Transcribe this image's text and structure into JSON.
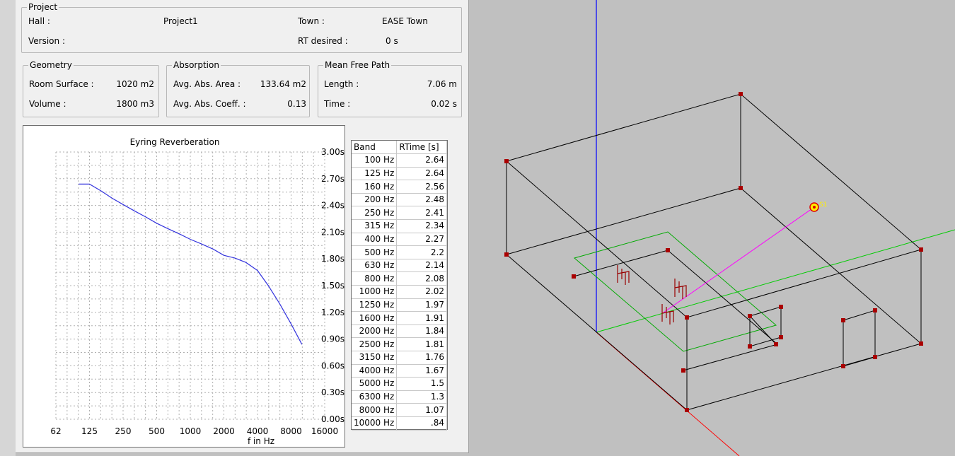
{
  "project": {
    "group_title": "Project",
    "hall_label": "Hall :",
    "hall_value": "Project1",
    "town_label": "Town :",
    "town_value": "EASE Town",
    "version_label": "Version :",
    "rt_desired_label": "RT desired :",
    "rt_desired_value": "0 s"
  },
  "geometry": {
    "group_title": "Geometry",
    "surface_label": "Room Surface :",
    "surface_value": "1020 m2",
    "volume_label": "Volume :",
    "volume_value": "1800 m3"
  },
  "absorption": {
    "group_title": "Absorption",
    "area_label": "Avg. Abs. Area :",
    "area_value": "133.64 m2",
    "coeff_label": "Avg. Abs. Coeff. :",
    "coeff_value": "0.13"
  },
  "mean_free_path": {
    "group_title": "Mean Free Path",
    "length_label": "Length :",
    "length_value": "7.06 m",
    "time_label": "Time :",
    "time_value": "0.02 s"
  },
  "table": {
    "col_band": "Band",
    "col_rtime": "RTime [s]",
    "rows": [
      {
        "band": "100 Hz",
        "rt": "2.64"
      },
      {
        "band": "125 Hz",
        "rt": "2.64"
      },
      {
        "band": "160 Hz",
        "rt": "2.56"
      },
      {
        "band": "200 Hz",
        "rt": "2.48"
      },
      {
        "band": "250 Hz",
        "rt": "2.41"
      },
      {
        "band": "315 Hz",
        "rt": "2.34"
      },
      {
        "band": "400 Hz",
        "rt": "2.27"
      },
      {
        "band": "500 Hz",
        "rt": "2.2"
      },
      {
        "band": "630 Hz",
        "rt": "2.14"
      },
      {
        "band": "800 Hz",
        "rt": "2.08"
      },
      {
        "band": "1000 Hz",
        "rt": "2.02"
      },
      {
        "band": "1250 Hz",
        "rt": "1.97"
      },
      {
        "band": "1600 Hz",
        "rt": "1.91"
      },
      {
        "band": "2000 Hz",
        "rt": "1.84"
      },
      {
        "band": "2500 Hz",
        "rt": "1.81"
      },
      {
        "band": "3150 Hz",
        "rt": "1.76"
      },
      {
        "band": "4000 Hz",
        "rt": "1.67"
      },
      {
        "band": "5000 Hz",
        "rt": "1.5"
      },
      {
        "band": "6300 Hz",
        "rt": "1.3"
      },
      {
        "band": "8000 Hz",
        "rt": "1.07"
      },
      {
        "band": "10000 Hz",
        "rt": ".84"
      }
    ]
  },
  "chart_data": {
    "type": "line",
    "title": "Eyring Reverberation",
    "xlabel": "f in Hz",
    "ylabel": "",
    "x_scale": "log",
    "xlim": [
      62,
      16000
    ],
    "ylim": [
      0,
      3.0
    ],
    "grid": true,
    "x_tick_labels": [
      "62",
      "125",
      "250",
      "500",
      "1000",
      "2000",
      "4000",
      "8000",
      "16000"
    ],
    "x_tick_values": [
      62.5,
      125,
      250,
      500,
      1000,
      2000,
      4000,
      8000,
      16000
    ],
    "y_tick_labels": [
      "3.00s",
      "2.70s",
      "2.40s",
      "2.10s",
      "1.80s",
      "1.50s",
      "1.20s",
      "0.90s",
      "0.60s",
      "0.30s",
      "0.00s"
    ],
    "y_tick_values": [
      3.0,
      2.7,
      2.4,
      2.1,
      1.8,
      1.5,
      1.2,
      0.9,
      0.6,
      0.3,
      0.0
    ],
    "x": [
      100,
      125,
      160,
      200,
      250,
      315,
      400,
      500,
      630,
      800,
      1000,
      1250,
      1600,
      2000,
      2500,
      3150,
      4000,
      5000,
      6300,
      8000,
      10000
    ],
    "values": [
      2.64,
      2.64,
      2.56,
      2.48,
      2.41,
      2.34,
      2.27,
      2.2,
      2.14,
      2.08,
      2.02,
      1.97,
      1.91,
      1.84,
      1.81,
      1.76,
      1.67,
      1.5,
      1.3,
      1.07,
      0.84
    ],
    "line_color": "#3333dd"
  },
  "view3d": {
    "source_label": "S1",
    "colors": {
      "edges": "#000000",
      "vertex": "#aa0000",
      "axis_z": "#0000ff",
      "axis_x": "#ff0000",
      "axis_y": "#00cc00",
      "audience_area": "#00aa00",
      "ray": "#ff00ff",
      "source": "#ffee00",
      "seat": "#990000"
    }
  }
}
